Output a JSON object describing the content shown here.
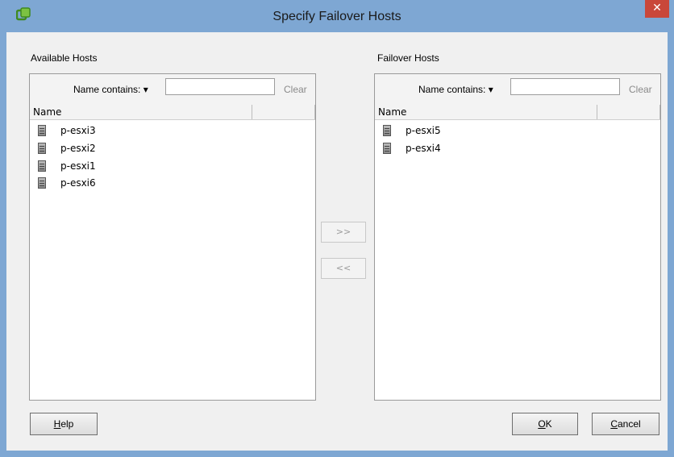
{
  "window": {
    "title": "Specify Failover Hosts",
    "close_glyph": "✕"
  },
  "available": {
    "label": "Available Hosts",
    "filter_label": "Name contains: ▾",
    "filter_value": "",
    "clear_label": "Clear",
    "column_name": "Name",
    "hosts": [
      "p-esxi3",
      "p-esxi2",
      "p-esxi1",
      "p-esxi6"
    ]
  },
  "failover": {
    "label": "Failover Hosts",
    "filter_label": "Name contains: ▾",
    "filter_value": "",
    "clear_label": "Clear",
    "column_name": "Name",
    "hosts": [
      "p-esxi5",
      "p-esxi4"
    ]
  },
  "transfer": {
    "add_label": ">>",
    "remove_label": "<<"
  },
  "buttons": {
    "help_mnemonic": "H",
    "help_rest": "elp",
    "ok_mnemonic": "O",
    "ok_rest": "K",
    "cancel_mnemonic": "C",
    "cancel_rest": "ancel"
  },
  "icons": {
    "app": "vsphere-app-icon",
    "host": "server-host-icon"
  },
  "colors": {
    "title_bar": "#7ea7d3",
    "close_button": "#c9473a",
    "client_bg": "#f0f0f0"
  }
}
